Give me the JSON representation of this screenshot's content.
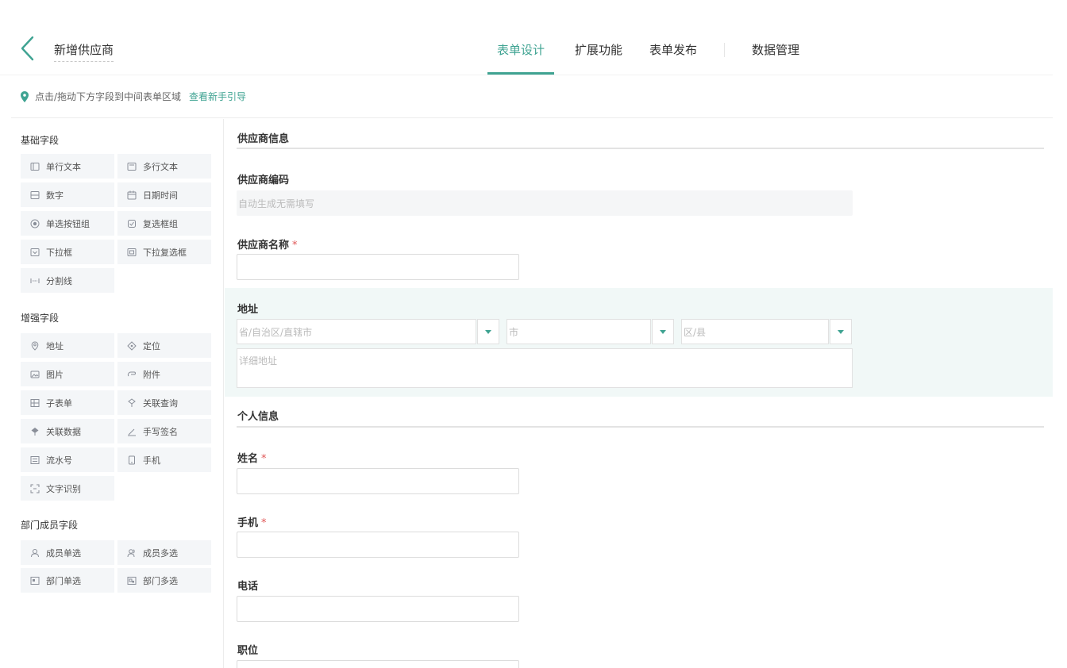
{
  "header": {
    "title": "新增供应商",
    "tabs": [
      {
        "label": "表单设计",
        "active": true
      },
      {
        "label": "扩展功能",
        "active": false
      },
      {
        "label": "表单发布",
        "active": false
      },
      {
        "label": "数据管理",
        "active": false
      }
    ]
  },
  "hint": {
    "text": "点击/拖动下方字段到中间表单区域",
    "link": "查看新手引导"
  },
  "sidebar": {
    "basic": {
      "title": "基础字段",
      "items": [
        {
          "label": "单行文本",
          "icon": "single-line-text-icon"
        },
        {
          "label": "多行文本",
          "icon": "multi-line-text-icon"
        },
        {
          "label": "数字",
          "icon": "number-icon"
        },
        {
          "label": "日期时间",
          "icon": "calendar-icon"
        },
        {
          "label": "单选按钮组",
          "icon": "radio-icon"
        },
        {
          "label": "复选框组",
          "icon": "checkbox-icon"
        },
        {
          "label": "下拉框",
          "icon": "dropdown-icon"
        },
        {
          "label": "下拉复选框",
          "icon": "multi-dropdown-icon"
        },
        {
          "label": "分割线",
          "icon": "divider-icon"
        }
      ]
    },
    "enhanced": {
      "title": "增强字段",
      "items": [
        {
          "label": "地址",
          "icon": "location-pin-icon"
        },
        {
          "label": "定位",
          "icon": "locate-icon"
        },
        {
          "label": "图片",
          "icon": "image-icon"
        },
        {
          "label": "附件",
          "icon": "attachment-icon"
        },
        {
          "label": "子表单",
          "icon": "subform-icon"
        },
        {
          "label": "关联查询",
          "icon": "relation-query-icon"
        },
        {
          "label": "关联数据",
          "icon": "relation-data-icon"
        },
        {
          "label": "手写签名",
          "icon": "signature-icon"
        },
        {
          "label": "流水号",
          "icon": "serial-number-icon"
        },
        {
          "label": "手机",
          "icon": "phone-icon"
        },
        {
          "label": "文字识别",
          "icon": "ocr-icon"
        }
      ]
    },
    "member": {
      "title": "部门成员字段",
      "items": [
        {
          "label": "成员单选",
          "icon": "member-single-icon"
        },
        {
          "label": "成员多选",
          "icon": "member-multi-icon"
        },
        {
          "label": "部门单选",
          "icon": "department-single-icon"
        },
        {
          "label": "部门多选",
          "icon": "department-multi-icon"
        }
      ]
    }
  },
  "form": {
    "group1_title": "供应商信息",
    "supplier_code": {
      "label": "供应商编码",
      "placeholder": "自动生成无需填写"
    },
    "supplier_name": {
      "label": "供应商名称",
      "required_mark": "*"
    },
    "address": {
      "label": "地址",
      "province_placeholder": "省/自治区/直辖市",
      "city_placeholder": "市",
      "district_placeholder": "区/县",
      "detail_placeholder": "详细地址"
    },
    "group2_title": "个人信息",
    "name": {
      "label": "姓名",
      "required_mark": "*"
    },
    "mobile": {
      "label": "手机",
      "required_mark": "*"
    },
    "phone": {
      "label": "电话"
    },
    "position": {
      "label": "职位"
    }
  },
  "colors": {
    "accent": "#3fa392",
    "required": "#e05757",
    "address_bg": "#f1f8f7"
  }
}
